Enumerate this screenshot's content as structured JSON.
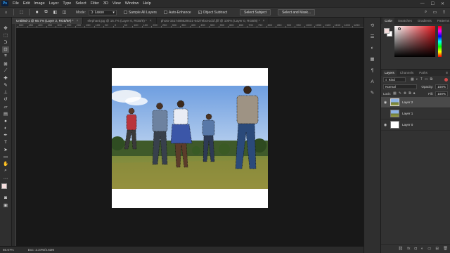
{
  "menubar": {
    "logo": "Ps",
    "items": [
      "File",
      "Edit",
      "Image",
      "Layer",
      "Type",
      "Select",
      "Filter",
      "3D",
      "View",
      "Window",
      "Help"
    ],
    "win_controls": [
      "—",
      "☐",
      "✕"
    ]
  },
  "options": {
    "mode_label": "Mode:",
    "mode_value": "Lasso",
    "sample_all_layers": "Sample All Layers",
    "auto_enhance": "Auto-Enhance",
    "object_subtract": "Object Subtract",
    "object_subtract_checked": true,
    "select_subject": "Select Subject",
    "select_and_mask": "Select and Mask..."
  },
  "tabs": [
    {
      "label": "Untitled-1 @ 66.7% (Layer 2, RGB/8#) *",
      "active": true
    },
    {
      "label": "elephant.jpg @ 16.7% (Layer 0, RGB/8) *",
      "active": false
    },
    {
      "label": "photo-1517486629431-6427ebce1d1f.jfif @ 100% (Layer 0, RGB/8) *",
      "active": false
    }
  ],
  "ruler": {
    "numbers": [
      "500",
      "450",
      "400",
      "350",
      "300",
      "250",
      "200",
      "150",
      "100",
      "50",
      "0",
      "50",
      "100",
      "150",
      "200",
      "250",
      "300",
      "350",
      "400",
      "450",
      "500",
      "550",
      "600",
      "650",
      "700",
      "750",
      "800",
      "850",
      "900",
      "950",
      "1000",
      "1050",
      "1100",
      "1150",
      "1200",
      "1250"
    ]
  },
  "status": {
    "zoom": "66.67%",
    "doc": "Doc: 2.37M/4.63M"
  },
  "color_panel": {
    "tabs": [
      "Color",
      "Swatches",
      "Gradients",
      "Patterns"
    ],
    "fg_color": "#f3dcdc",
    "bg_color": "#ffffff"
  },
  "layers_panel": {
    "tabs": [
      "Layers",
      "Channels",
      "Paths"
    ],
    "kind_label": "Kind",
    "blend_mode": "Normal",
    "opacity_label": "Opacity:",
    "opacity_value": "100%",
    "lock_label": "Lock:",
    "fill_label": "Fill:",
    "fill_value": "100%",
    "layers": [
      {
        "name": "Layer 2",
        "selected": true,
        "visible": true
      },
      {
        "name": "Layer 1",
        "selected": false,
        "visible": false
      },
      {
        "name": "Layer 0",
        "selected": false,
        "visible": true
      }
    ]
  }
}
